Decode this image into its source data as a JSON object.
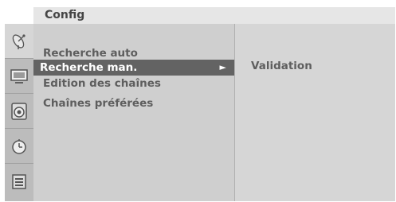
{
  "header": {
    "title": "Config"
  },
  "icons": [
    {
      "name": "satellite-dish-icon",
      "active": true
    },
    {
      "name": "tv-screen-icon",
      "active": false
    },
    {
      "name": "speaker-icon",
      "active": false
    },
    {
      "name": "clock-icon",
      "active": false
    },
    {
      "name": "lock-box-icon",
      "active": false
    }
  ],
  "menu": {
    "items": [
      {
        "label": "Recherche auto"
      },
      {
        "label": "Recherche man.",
        "selected": true,
        "arrow": "►"
      },
      {
        "label": "Edition des chaînes"
      },
      {
        "label": "Chaînes préférées"
      }
    ]
  },
  "submenu": {
    "label": "Validation"
  }
}
